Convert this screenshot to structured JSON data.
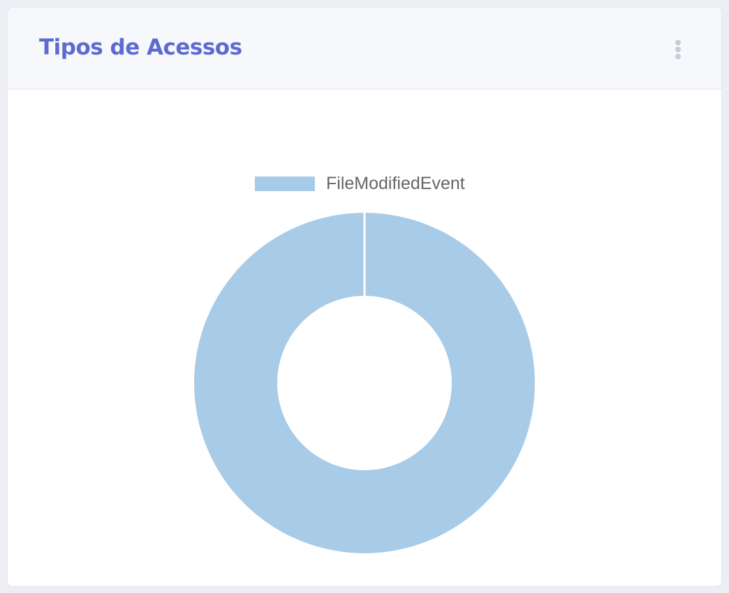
{
  "card": {
    "title": "Tipos de Acessos",
    "menu_icon": "more-vertical-icon"
  },
  "colors": {
    "title": "#5d6bd1",
    "slice": "#a8cbe7",
    "background": "#eceef3"
  },
  "chart_data": {
    "type": "pie",
    "variant": "doughnut",
    "title": "",
    "legend_position": "top",
    "categories": [
      "FileModifiedEvent"
    ],
    "values": [
      1
    ]
  }
}
